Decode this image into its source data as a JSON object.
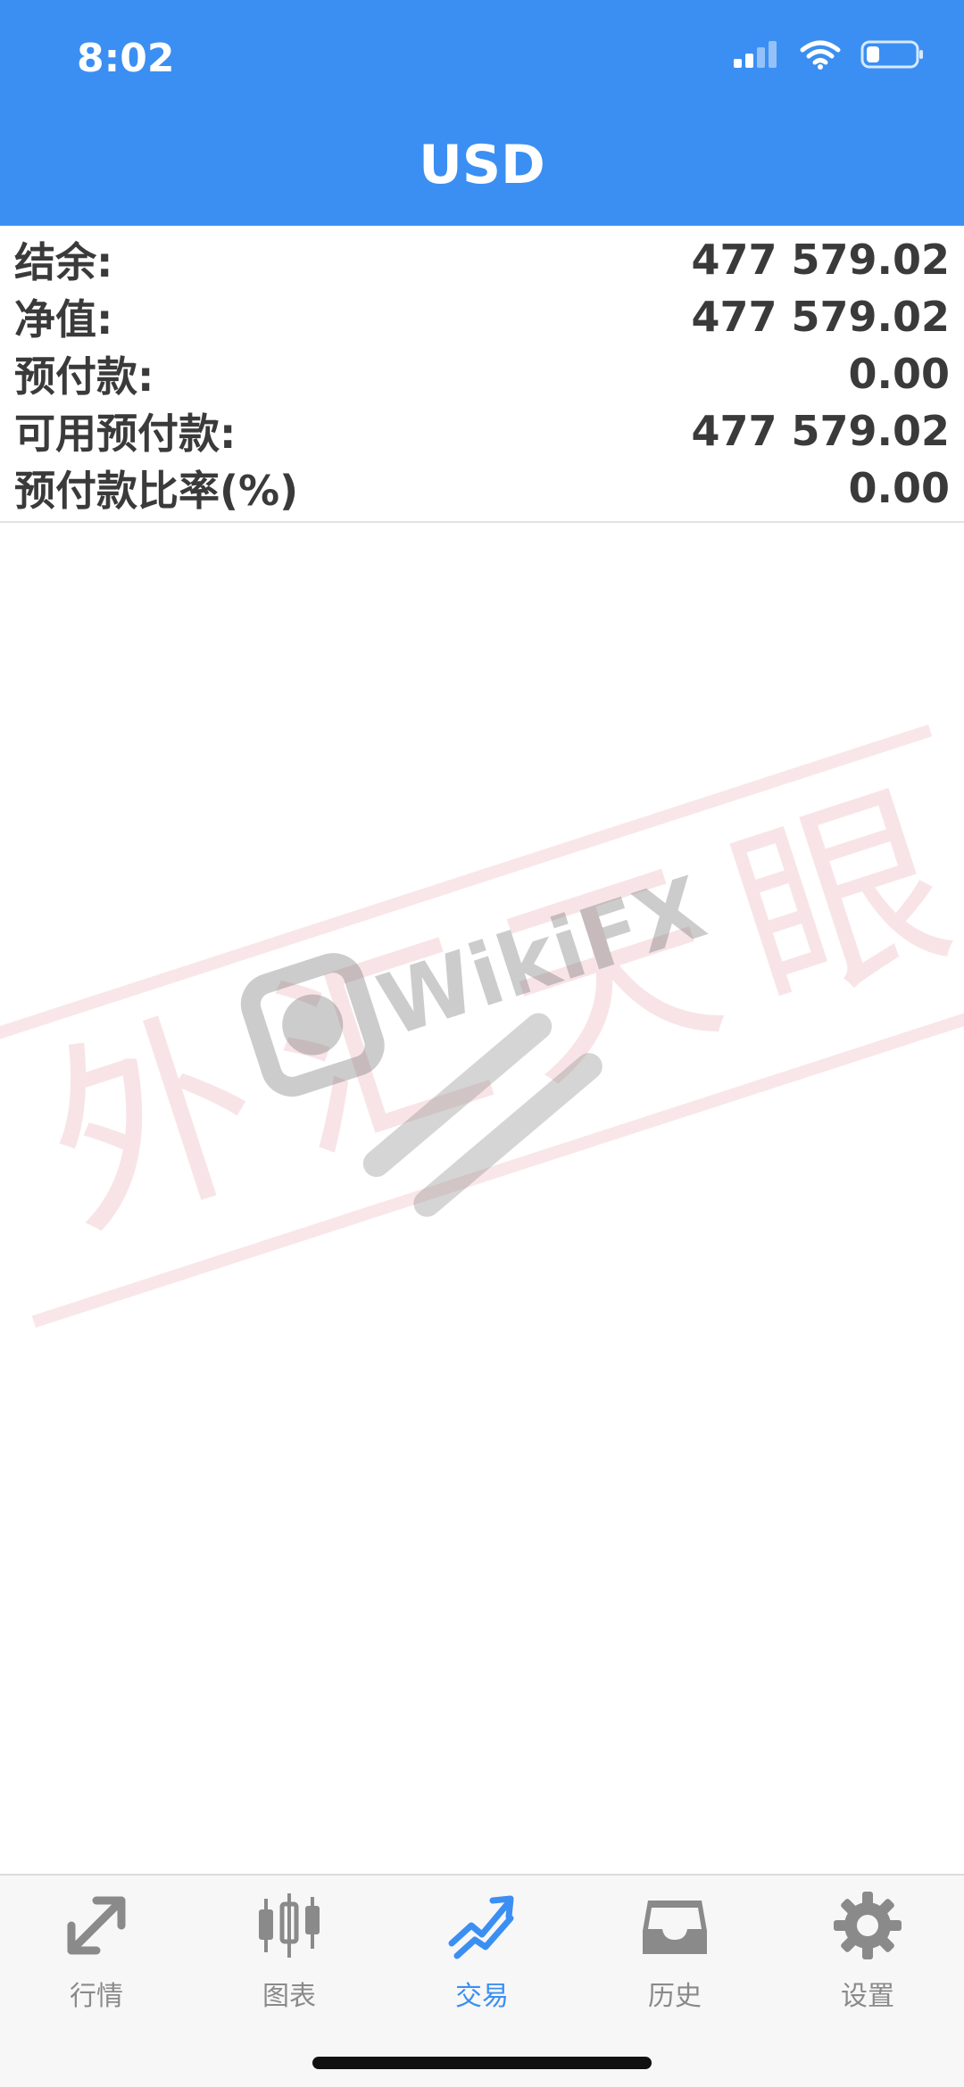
{
  "status_bar": {
    "time": "8:02",
    "icons": [
      "cellular-signal-icon",
      "wifi-icon",
      "battery-icon"
    ]
  },
  "nav": {
    "title": "USD"
  },
  "account": {
    "rows": [
      {
        "label": "结余:",
        "value": "477 579.02"
      },
      {
        "label": "净值:",
        "value": "477 579.02"
      },
      {
        "label": "预付款:",
        "value": "0.00"
      },
      {
        "label": "可用预付款:",
        "value": "477 579.02"
      },
      {
        "label": "预付款比率(%)",
        "value": "0.00"
      }
    ]
  },
  "watermark": {
    "brand": "WikiFX",
    "text": "外汇天眼"
  },
  "tabbar": {
    "tabs": [
      {
        "label": "行情",
        "icon": "quotes-arrows-icon",
        "active": false
      },
      {
        "label": "图表",
        "icon": "candlestick-chart-icon",
        "active": false
      },
      {
        "label": "交易",
        "icon": "trade-trend-icon",
        "active": true
      },
      {
        "label": "历史",
        "icon": "history-inbox-icon",
        "active": false
      },
      {
        "label": "设置",
        "icon": "settings-gear-icon",
        "active": false
      }
    ]
  },
  "colors": {
    "header_bg": "#3b8ff2",
    "active_tab": "#3b8ff2",
    "inactive_tab": "#8a8a8a",
    "text": "#3a3a3a"
  }
}
